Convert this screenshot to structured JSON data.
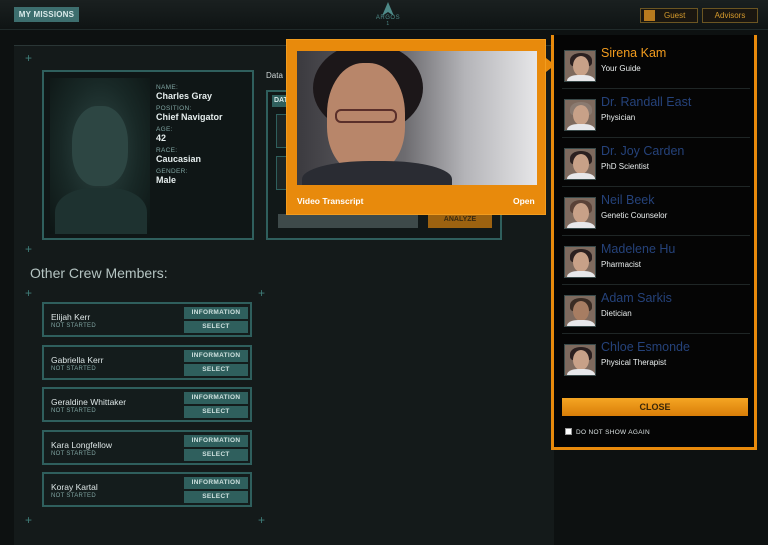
{
  "topbar": {
    "missions_label": "MY MISSIONS",
    "logo_text": "ARGOS",
    "logo_sup": "1",
    "guest_label": "Guest",
    "advisors_label": "Advisors"
  },
  "profile": {
    "labels": {
      "name": "NAME:",
      "position": "POSITION:",
      "age": "AGE:",
      "race": "RACE:",
      "gender": "GENDER:"
    },
    "values": {
      "name": "Charles Gray",
      "position": "Chief Navigator",
      "age": "42",
      "race": "Caucasian",
      "gender": "Male"
    }
  },
  "data_panel": {
    "label": "Data",
    "header": "DAT",
    "analyze_label": "ANALYZE"
  },
  "crew": {
    "title": "Other Crew Members:",
    "info_label": "INFORMATION",
    "select_label": "SELECT",
    "members": [
      {
        "name": "Elijah Kerr",
        "status": "NOT STARTED"
      },
      {
        "name": "Gabriella Kerr",
        "status": "NOT STARTED"
      },
      {
        "name": "Geraldine Whittaker",
        "status": "NOT STARTED"
      },
      {
        "name": "Kara Longfellow",
        "status": "NOT STARTED"
      },
      {
        "name": "Koray Kartal",
        "status": "NOT STARTED"
      }
    ]
  },
  "video_popup": {
    "transcript_label": "Video Transcript",
    "open_label": "Open"
  },
  "advisors": {
    "items": [
      {
        "name": "Sirena Kam",
        "role": "Your Guide"
      },
      {
        "name": "Dr. Randall East",
        "role": "Physician"
      },
      {
        "name": "Dr. Joy Carden",
        "role": "PhD Scientist"
      },
      {
        "name": "Neil Beek",
        "role": "Genetic Counselor"
      },
      {
        "name": "Madelene Hu",
        "role": "Pharmacist"
      },
      {
        "name": "Adam Sarkis",
        "role": "Dietician"
      },
      {
        "name": "Chloe Esmonde",
        "role": "Physical Therapist"
      }
    ],
    "close_label": "CLOSE",
    "dont_show_label": "DO NOT SHOW AGAIN"
  },
  "colors": {
    "accent": "#e88a0c",
    "teal": "#2f5f5d",
    "inactive_name": "#25427a"
  }
}
